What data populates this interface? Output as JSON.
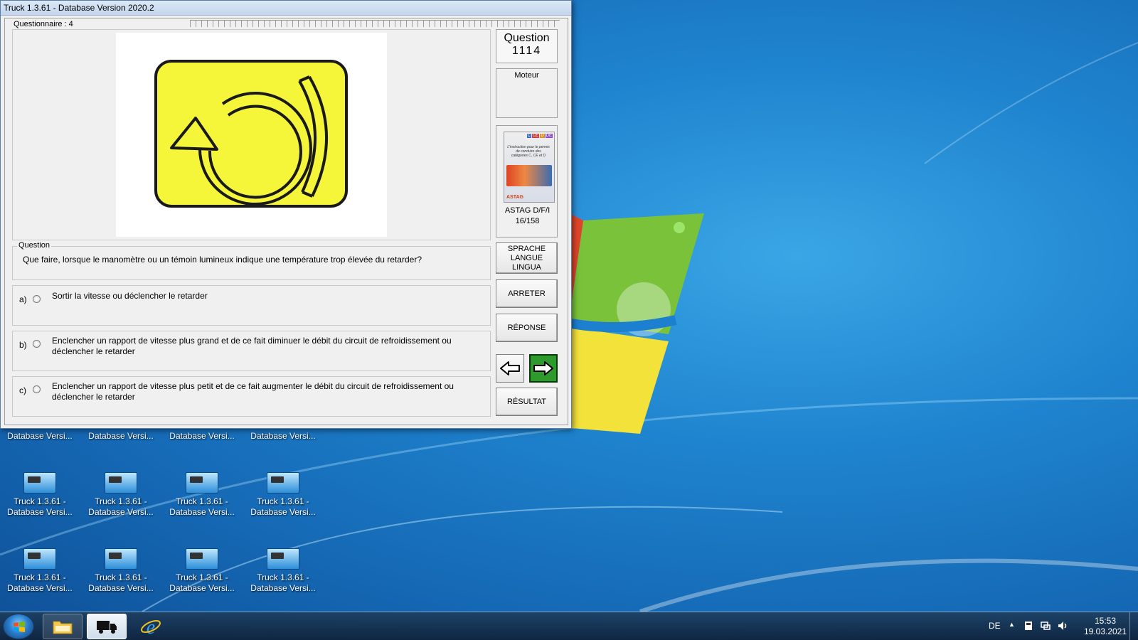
{
  "window": {
    "title": "Truck 1.3.61 - Database Version 2020.2"
  },
  "progress": {
    "label": "Questionnaire : 4"
  },
  "question": {
    "number_label": "Question",
    "number": "1114",
    "group_title": "Question",
    "text": "Que faire, lorsque le manomètre ou un témoin lumineux indique une température trop élevée du retarder?",
    "category": "Moteur"
  },
  "answers": [
    {
      "letter": "a)",
      "text": "Sortir la vitesse ou déclencher le retarder"
    },
    {
      "letter": "b)",
      "text": "Enclencher un rapport de vitesse plus grand et de ce fait diminuer le débit du circuit de refroidissement ou déclencher le retarder"
    },
    {
      "letter": "c)",
      "text": "Enclencher un rapport de vitesse plus petit et de ce fait augmenter le débit du circuit de refroidissement ou déclencher le retarder"
    }
  ],
  "book": {
    "tags": [
      "C",
      "CE",
      "D",
      "DE"
    ],
    "cover_text": "L'instruction pour le permis de conduire des catégories C, CE et D",
    "brand": "ASTAG",
    "label_line1": "ASTAG D/F/I",
    "label_line2": "16/158"
  },
  "buttons": {
    "language": "SPRACHE\nLANGUE\nLINGUA",
    "stop": "ARRETER",
    "answer": "RÉPONSE",
    "result": "RÉSULTAT"
  },
  "desktop_icons": [
    {
      "label": "Database Versi..."
    },
    {
      "label": "Database Versi..."
    },
    {
      "label": "Database Versi..."
    },
    {
      "label": "Database Versi..."
    },
    {
      "label": "Truck 1.3.61 -\nDatabase Versi..."
    },
    {
      "label": "Truck 1.3.61 -\nDatabase Versi..."
    },
    {
      "label": "Truck 1.3.61 -\nDatabase Versi..."
    },
    {
      "label": "Truck 1.3.61 -\nDatabase Versi..."
    },
    {
      "label": "Truck 1.3.61 -\nDatabase Versi..."
    },
    {
      "label": "Truck 1.3.61 -\nDatabase Versi..."
    },
    {
      "label": "Truck 1.3.61 -\nDatabase Versi..."
    },
    {
      "label": "Truck 1.3.61 -\nDatabase Versi..."
    }
  ],
  "taskbar": {
    "language": "DE",
    "time": "15:53",
    "date": "19.03.2021",
    "items": [
      "file-explorer-icon",
      "truck-app-icon",
      "internet-explorer-icon"
    ]
  },
  "colors": {
    "warning_yellow": "#f5f53a",
    "next_button_green": "#2e9a2e"
  }
}
